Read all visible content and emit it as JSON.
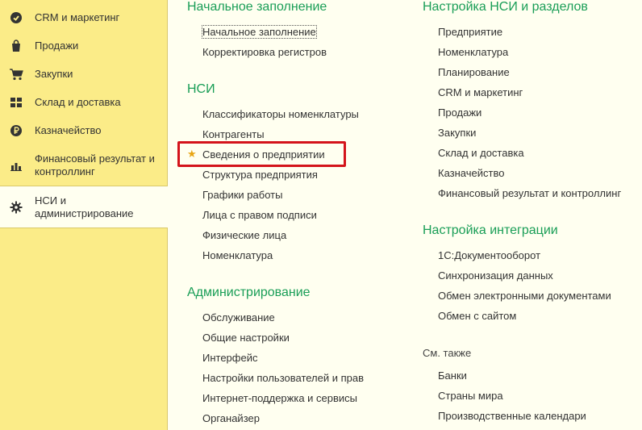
{
  "sidebar": {
    "items": [
      {
        "label": "CRM и маркетинг",
        "icon": "crm-icon"
      },
      {
        "label": "Продажи",
        "icon": "shopping-bag-icon"
      },
      {
        "label": "Закупки",
        "icon": "cart-icon"
      },
      {
        "label": "Склад и доставка",
        "icon": "warehouse-icon"
      },
      {
        "label": "Казначейство",
        "icon": "ruble-icon"
      },
      {
        "label": "Финансовый результат и контроллинг",
        "icon": "bar-chart-icon"
      },
      {
        "label": "НСИ и администрирование",
        "icon": "gear-icon",
        "active": true
      }
    ]
  },
  "left": {
    "initial": {
      "title": "Начальное заполнение",
      "links": [
        "Начальное заполнение",
        "Корректировка регистров"
      ]
    },
    "nsi": {
      "title": "НСИ",
      "links": [
        "Классификаторы номенклатуры",
        "Контрагенты",
        "Сведения о предприятии",
        "Структура предприятия",
        "Графики работы",
        "Лица с правом подписи",
        "Физические лица",
        "Номенклатура"
      ]
    },
    "admin": {
      "title": "Администрирование",
      "links": [
        "Обслуживание",
        "Общие настройки",
        "Интерфейс",
        "Настройки пользователей и прав",
        "Интернет-поддержка и сервисы",
        "Органайзер"
      ]
    }
  },
  "right": {
    "nsi_settings": {
      "title": "Настройка НСИ и разделов",
      "links": [
        "Предприятие",
        "Номенклатура",
        "Планирование",
        "CRM и маркетинг",
        "Продажи",
        "Закупки",
        "Склад и доставка",
        "Казначейство",
        "Финансовый результат и контроллинг"
      ]
    },
    "integration": {
      "title": "Настройка интеграции",
      "links": [
        "1С:Документооборот",
        "Синхронизация данных",
        "Обмен электронными документами",
        "Обмен с сайтом"
      ]
    },
    "see_also": {
      "title": "См. также",
      "links": [
        "Банки",
        "Страны мира",
        "Производственные календари"
      ]
    }
  },
  "colors": {
    "sidebar_bg": "#fbec88",
    "content_bg": "#fffff0",
    "section_title": "#1a9e57",
    "highlight": "#d4141b",
    "star": "#e8a512"
  }
}
